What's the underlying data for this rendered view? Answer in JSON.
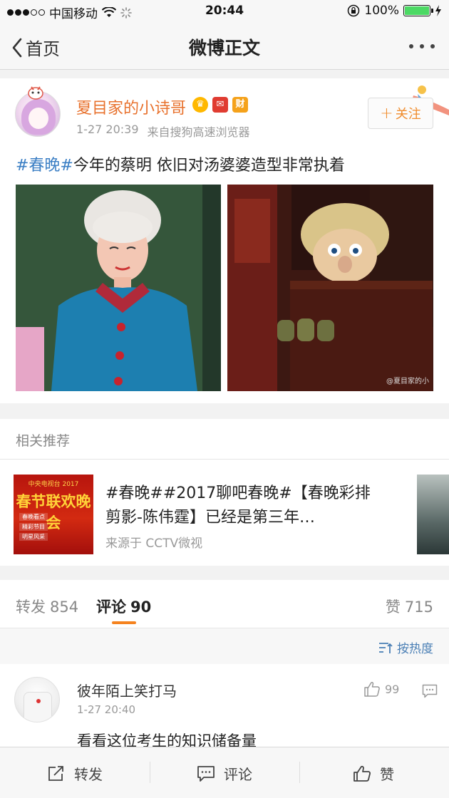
{
  "status": {
    "carrier": "中国移动",
    "time": "20:44",
    "battery": "100%"
  },
  "nav": {
    "back_label": "首页",
    "title": "微博正文"
  },
  "post": {
    "author": "夏目家的小诗哥",
    "badge_cai": "财",
    "time": "1-27 20:39",
    "source": "来自搜狗高速浏览器",
    "follow_label": "关注",
    "text_tag": "#春晚#",
    "text_body": "今年的蔡明 依旧对汤婆婆造型非常执着",
    "image_watermark": "@夏目家的小"
  },
  "related": {
    "header": "相关推荐",
    "title": "#春晚##2017聊吧春晚#【春晚彩排剪影-陈伟霆】已经是第三年…",
    "source": "来源于 CCTV微视",
    "thumb_top": "中央电视台 2017",
    "thumb_big": "春节联欢晚会",
    "thumb_items": [
      "春晚看点",
      "精彩节目",
      "明星风采"
    ]
  },
  "tabs": {
    "repost_label": "转发",
    "repost_count": "854",
    "comment_label": "评论",
    "comment_count": "90",
    "like_label": "赞",
    "like_count": "715"
  },
  "sort": {
    "label": "按热度"
  },
  "comment": {
    "name": "彼年陌上笑打马",
    "time": "1-27 20:40",
    "text": "看看这位考生的知识储备量",
    "likes": "99"
  },
  "bottom": {
    "repost": "转发",
    "comment": "评论",
    "like": "赞"
  },
  "colors": {
    "accent_orange": "#f5831f",
    "username": "#e8722e",
    "link_blue": "#3a7ec4"
  }
}
